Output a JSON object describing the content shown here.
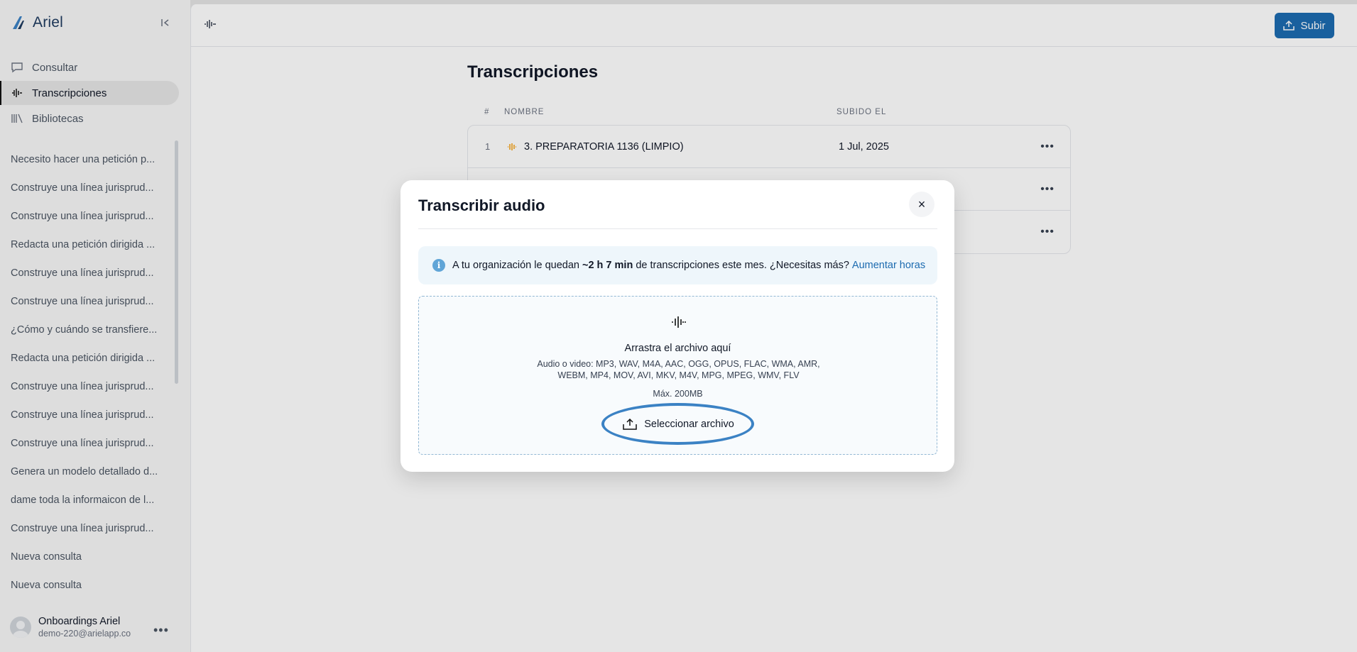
{
  "app": {
    "name": "Ariel",
    "collapse_icon": "collapse-sidebar-icon"
  },
  "nav": [
    {
      "label": "Consultar",
      "icon": "chat-icon",
      "active": false
    },
    {
      "label": "Transcripciones",
      "icon": "waveform-icon",
      "active": true
    },
    {
      "label": "Bibliotecas",
      "icon": "library-icon",
      "active": false
    }
  ],
  "history": [
    "Necesito hacer una petición p...",
    "Construye una línea jurisprud...",
    "Construye una línea jurisprud...",
    "Redacta una petición dirigida ...",
    "Construye una línea jurisprud...",
    "Construye una línea jurisprud...",
    "¿Cómo y cuándo se transfiere...",
    "Redacta una petición dirigida ...",
    "Construye una línea jurisprud...",
    "Construye una línea jurisprud...",
    "Construye una línea jurisprud...",
    "Genera un modelo detallado d...",
    "dame toda la informaicon de l...",
    "Construye una línea jurisprud...",
    "Nueva consulta",
    "Nueva consulta"
  ],
  "user": {
    "name": "Onboardings Ariel",
    "email": "demo-220@arielapp.co",
    "menu": "•••"
  },
  "topbar": {
    "upload_label": "Subir"
  },
  "page": {
    "title": "Transcripciones",
    "columns": {
      "num": "#",
      "name": "NOMBRE",
      "uploaded": "SUBIDO EL"
    },
    "rows": [
      {
        "num": "1",
        "name": "3. PREPARATORIA 1136 (LIMPIO)",
        "date": "1 Jul, 2025",
        "menu": "•••"
      },
      {
        "num": "",
        "name": "",
        "date": "",
        "menu": "•••"
      },
      {
        "num": "",
        "name": "",
        "date": "",
        "menu": "•••"
      }
    ]
  },
  "modal": {
    "title": "Transcribir audio",
    "close": "×",
    "info": {
      "prefix": "A tu organización le quedan",
      "highlight": "~2 h 7 min",
      "suffix": "de transcripciones este mes. ¿Necesitas más?",
      "link": "Aumentar horas",
      "icon_text": "i"
    },
    "dropzone": {
      "title": "Arrastra el archivo aquí",
      "formats": "Audio o video: MP3, WAV, M4A, AAC, OGG, OPUS, FLAC, WMA, AMR, WEBM, MP4, MOV, AVI, MKV, M4V, MPG, MPEG, WMV, FLV",
      "max": "Máx. 200MB",
      "button": "Seleccionar archivo"
    }
  },
  "colors": {
    "accent": "#1c6bb0",
    "highlight_ring": "#3b82c4",
    "waveform_row": "#f59e0b"
  }
}
